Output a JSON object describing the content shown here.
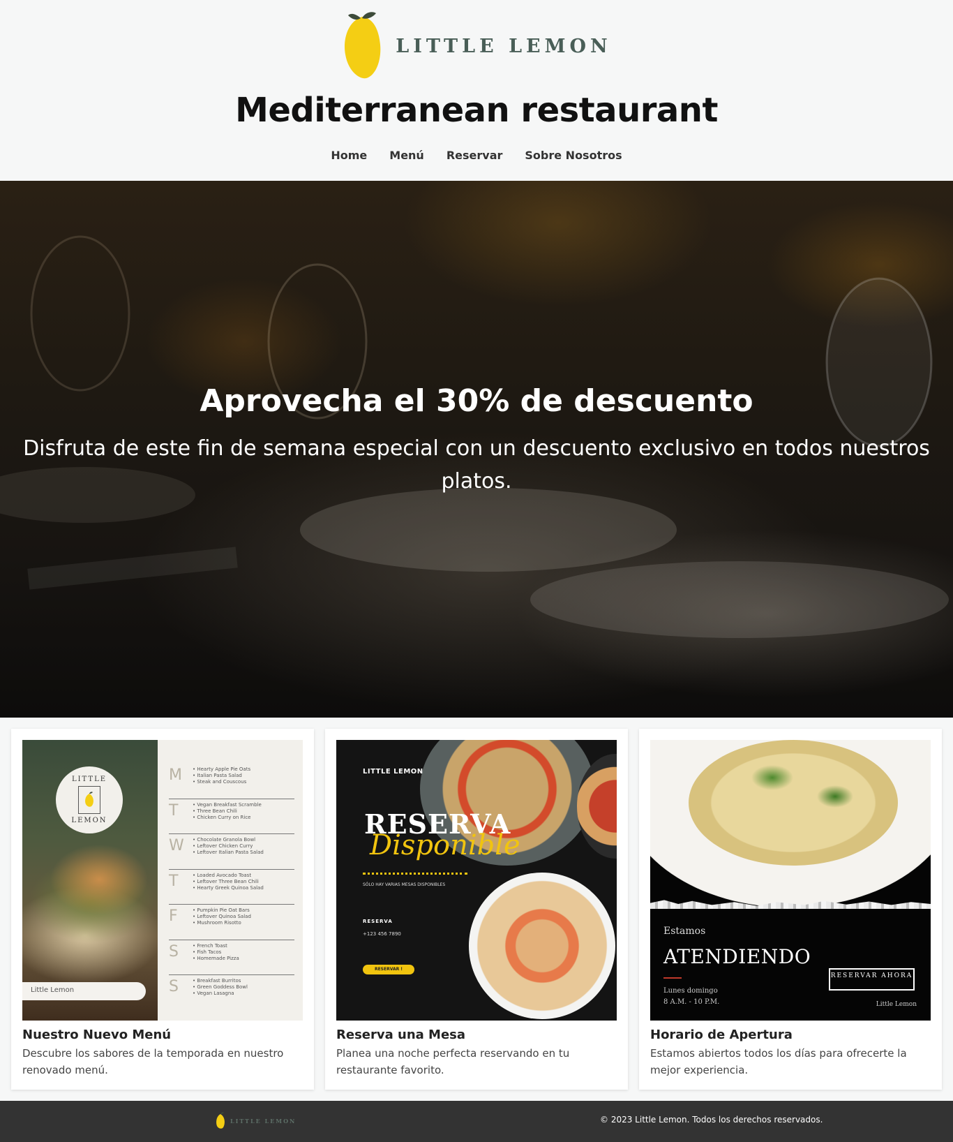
{
  "header": {
    "logo_text": "LITTLE LEMON",
    "title": "Mediterranean restaurant",
    "nav": [
      "Home",
      "Menú",
      "Reservar",
      "Sobre Nosotros"
    ]
  },
  "hero": {
    "title": "Aprovecha el 30% de descuento",
    "subtitle": "Disfruta de este fin de semana especial con un descuento exclusivo en todos nuestros platos."
  },
  "cards": [
    {
      "title": "Nuestro Nuevo Menú",
      "description": "Descubre los sabores de la temporada en nuestro renovado menú.",
      "image": {
        "badge_top": "LITTLE",
        "badge_bottom": "LEMON",
        "pill": "Little Lemon",
        "days": [
          {
            "letter": "M",
            "items": [
              "Hearty Apple Pie Oats",
              "Italian Pasta Salad",
              "Steak and Couscous"
            ]
          },
          {
            "letter": "T",
            "items": [
              "Vegan Breakfast Scramble",
              "Three Bean Chili",
              "Chicken Curry on Rice"
            ]
          },
          {
            "letter": "W",
            "items": [
              "Chocolate Granola Bowl",
              "Leftover Chicken Curry",
              "Leftover Italian Pasta Salad"
            ]
          },
          {
            "letter": "T",
            "items": [
              "Loaded Avocado Toast",
              "Leftover Three Bean Chili",
              "Hearty Greek Quinoa Salad"
            ]
          },
          {
            "letter": "F",
            "items": [
              "Pumpkin Pie Oat Bars",
              "Leftover Quinoa Salad",
              "Mushroom Risotto"
            ]
          },
          {
            "letter": "S",
            "items": [
              "French Toast",
              "Fish Tacos",
              "Homemade Pizza"
            ]
          },
          {
            "letter": "S",
            "items": [
              "Breakfast Burritos",
              "Green Goddess Bowl",
              "Vegan Lasagna"
            ]
          }
        ]
      }
    },
    {
      "title": "Reserva una Mesa",
      "description": "Planea una noche perfecta reservando en tu restaurante favorito.",
      "image": {
        "brand": "LITTLE LEMON",
        "big": "RESERVA",
        "script": "Disponible",
        "small": "SÓLO HAY VARIAS MESAS DISPONIBLES",
        "label": "RESERVA",
        "phone": "+123 456 7890",
        "button": "RESERVAR !"
      }
    },
    {
      "title": "Horario de Apertura",
      "description": "Estamos abiertos todos los días para ofrecerte la mejor experiencia.",
      "image": {
        "estamos": "Estamos",
        "big": "ATENDIENDO",
        "days": "Lunes domingo",
        "hours": "8 A.M. - 10 P.M.",
        "button": "RESERVAR AHORA",
        "brand": "Little Lemon"
      }
    }
  ],
  "footer": {
    "logo_text": "LITTLE LEMON",
    "copyright": "© 2023 Little Lemon. Todos los derechos reservados."
  },
  "colors": {
    "brand_green": "#495e57",
    "lemon_yellow": "#f4ce14",
    "footer_bg": "#333333"
  }
}
